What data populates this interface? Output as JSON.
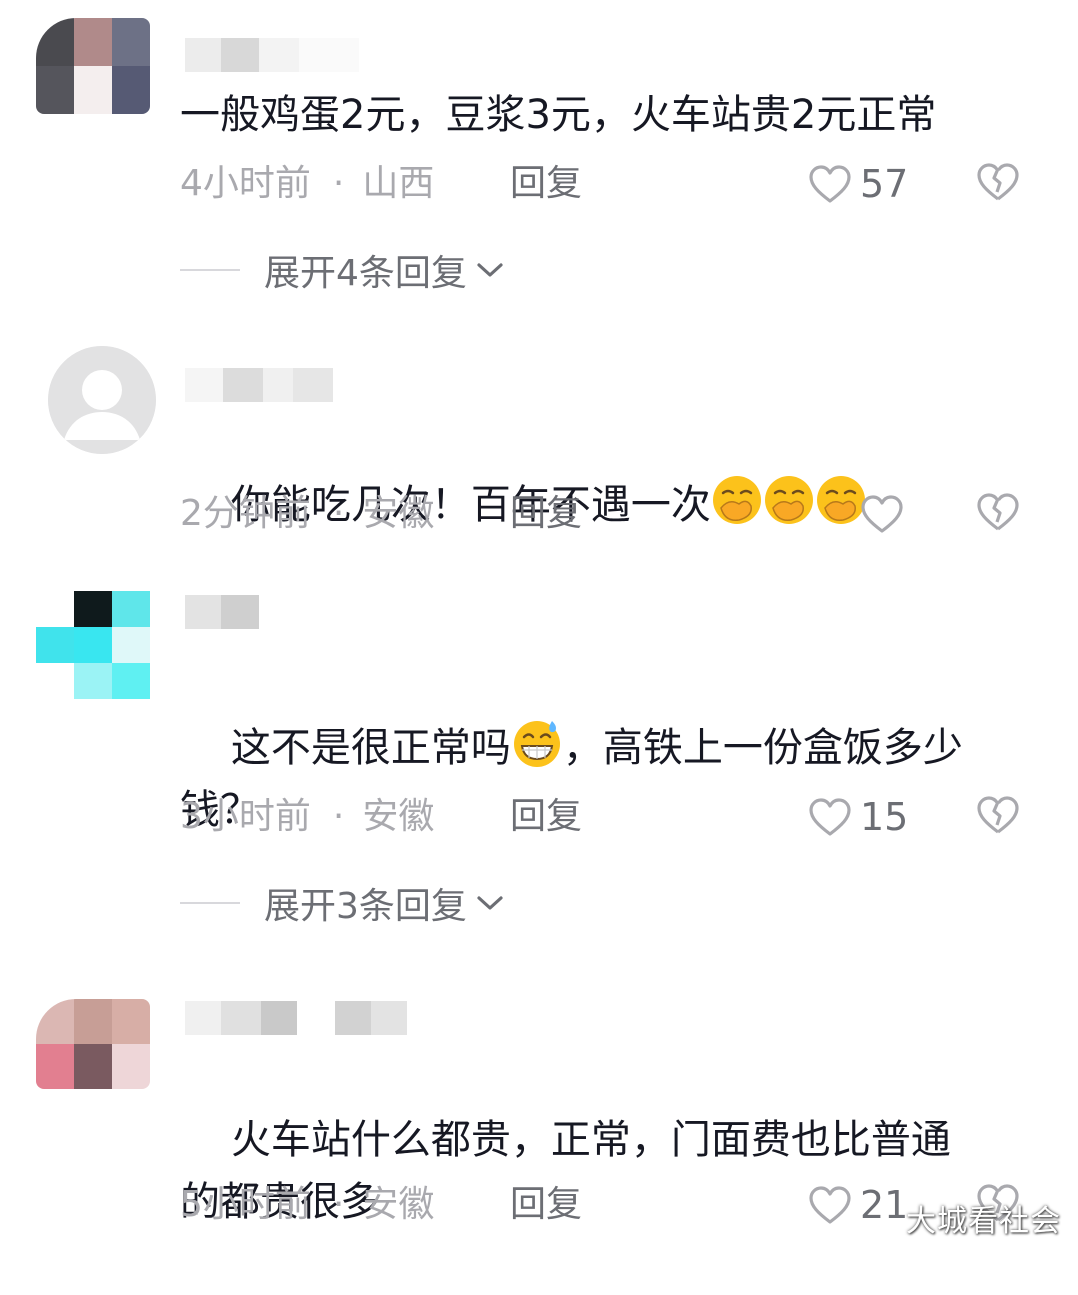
{
  "comments": [
    {
      "text": "一般鸡蛋2元，豆浆3元，火车站贵2元正常",
      "time": "4小时前",
      "region": "山西",
      "reply_label": "回复",
      "likes": "57",
      "expand": "展开4条回复"
    },
    {
      "text": "你能吃几次！百年不遇一次",
      "time": "2分钟前",
      "region": "安徽",
      "reply_label": "回复",
      "likes": ""
    },
    {
      "text_a": "这不是很正常吗",
      "text_b": "，高铁上一份盒饭多少",
      "text_c": "钱？",
      "time": "3小时前",
      "region": "安徽",
      "reply_label": "回复",
      "likes": "15",
      "expand": "展开3条回复"
    },
    {
      "text_line1": "火车站什么都贵，正常，门面费也比普通",
      "text_line2": "的都贵很多",
      "time": "5小时前",
      "region": "安徽",
      "reply_label": "回复",
      "likes": "21"
    }
  ],
  "separator": "·",
  "icons": {
    "like": "heart-outline-icon",
    "dislike": "broken-heart-icon",
    "expand": "chevron-down-icon",
    "emoji_cover_mouth": "face-hand-over-mouth-emoji",
    "emoji_grin_sweat": "grinning-sweat-emoji"
  },
  "colors": {
    "text": "#161823",
    "meta": "#a9a9ae",
    "action": "#6c6e74"
  },
  "watermark": "大城看社会"
}
